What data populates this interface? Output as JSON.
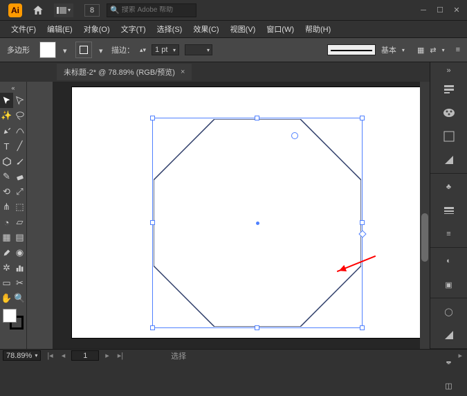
{
  "app": {
    "initials": "Ai"
  },
  "titlebar": {
    "sync_badge": "8",
    "search_placeholder": "搜索 Adobe 帮助"
  },
  "menu": {
    "file": "文件(F)",
    "edit": "编辑(E)",
    "object": "对象(O)",
    "type": "文字(T)",
    "select": "选择(S)",
    "effect": "效果(C)",
    "view": "视图(V)",
    "window": "窗口(W)",
    "help": "帮助(H)"
  },
  "control": {
    "shape_name": "多边形",
    "stroke_label": "描边：",
    "stroke_value": "1 pt",
    "style_label": "基本"
  },
  "tab": {
    "title": "未标题-2* @ 78.89% (RGB/预览)"
  },
  "status": {
    "zoom": "78.89%",
    "page": "1",
    "mode": "选择"
  },
  "shape": {
    "type": "octagon",
    "sides": 8,
    "stroke": "#2b3a67",
    "fill": "none",
    "selected": true
  }
}
